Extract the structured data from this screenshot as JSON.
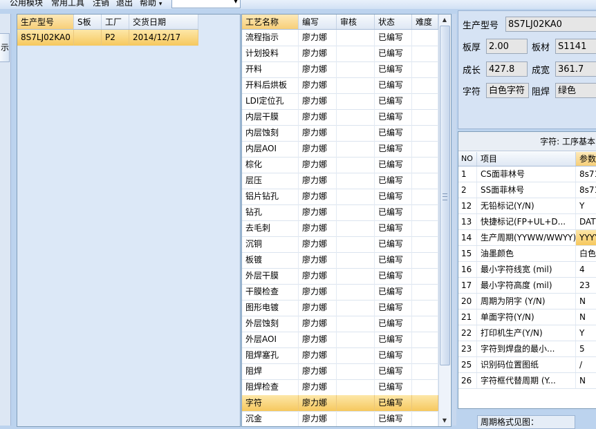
{
  "menu": {
    "items": [
      "公用模块",
      "常用工具",
      "注销",
      "退出",
      "帮助"
    ],
    "help_arrow": "▾"
  },
  "left_strip": {
    "button_label": "示"
  },
  "orders": {
    "columns": [
      "生产型号",
      "S板",
      "工厂",
      "交货日期"
    ],
    "rows": [
      [
        "8S7LJ02KA0",
        "",
        "P2",
        "2014/12/17"
      ]
    ]
  },
  "processes": {
    "columns": [
      "工艺名称",
      "编写",
      "审核",
      "状态",
      "难度"
    ],
    "rows": [
      [
        "流程指示",
        "廖力娜",
        "",
        "已编写",
        ""
      ],
      [
        "计划投料",
        "廖力娜",
        "",
        "已编写",
        ""
      ],
      [
        "开料",
        "廖力娜",
        "",
        "已编写",
        ""
      ],
      [
        "开料后烘板",
        "廖力娜",
        "",
        "已编写",
        ""
      ],
      [
        "LDI定位孔",
        "廖力娜",
        "",
        "已编写",
        ""
      ],
      [
        "内层干膜",
        "廖力娜",
        "",
        "已编写",
        ""
      ],
      [
        "内层蚀刻",
        "廖力娜",
        "",
        "已编写",
        ""
      ],
      [
        "内层AOI",
        "廖力娜",
        "",
        "已编写",
        ""
      ],
      [
        "棕化",
        "廖力娜",
        "",
        "已编写",
        ""
      ],
      [
        "层压",
        "廖力娜",
        "",
        "已编写",
        ""
      ],
      [
        "铝片钻孔",
        "廖力娜",
        "",
        "已编写",
        ""
      ],
      [
        "钻孔",
        "廖力娜",
        "",
        "已编写",
        ""
      ],
      [
        "去毛刺",
        "廖力娜",
        "",
        "已编写",
        ""
      ],
      [
        "沉铜",
        "廖力娜",
        "",
        "已编写",
        ""
      ],
      [
        "板镀",
        "廖力娜",
        "",
        "已编写",
        ""
      ],
      [
        "外层干膜",
        "廖力娜",
        "",
        "已编写",
        ""
      ],
      [
        "干膜检查",
        "廖力娜",
        "",
        "已编写",
        ""
      ],
      [
        "图形电镀",
        "廖力娜",
        "",
        "已编写",
        ""
      ],
      [
        "外层蚀刻",
        "廖力娜",
        "",
        "已编写",
        ""
      ],
      [
        "外层AOI",
        "廖力娜",
        "",
        "已编写",
        ""
      ],
      [
        "阻焊塞孔",
        "廖力娜",
        "",
        "已编写",
        ""
      ],
      [
        "阻焊",
        "廖力娜",
        "",
        "已编写",
        ""
      ],
      [
        "阻焊检查",
        "廖力娜",
        "",
        "已编写",
        ""
      ],
      [
        "字符",
        "廖力娜",
        "",
        "已编写",
        ""
      ],
      [
        "沉金",
        "廖力娜",
        "",
        "已编写",
        ""
      ]
    ],
    "selected_index": 23
  },
  "details": {
    "model_label": "生产型号",
    "model_value": "8S7LJ02KA0",
    "thickness_label": "板厚",
    "thickness_value": "2.00",
    "material_label": "板材",
    "material_value": "S1141",
    "length_label": "成长",
    "length_value": "427.8",
    "width_label": "成宽",
    "width_value": "361.7",
    "char_label": "字符",
    "char_value": "白色字符",
    "mask_label": "阻焊",
    "mask_value": "绿色"
  },
  "params": {
    "title": "字符: 工序基本",
    "columns": [
      "NO",
      "项目",
      "参数"
    ],
    "rows": [
      [
        "1",
        "CS面菲林号",
        "8s71"
      ],
      [
        "2",
        "SS面菲林号",
        "8s71"
      ],
      [
        "12",
        "无铅标记(Y/N)",
        "Y"
      ],
      [
        "13",
        "快捷标记(FP+UL+D...",
        "DATE"
      ],
      [
        "14",
        "生产周期(YYWW/WWYY)",
        "YYYY"
      ],
      [
        "15",
        "油墨颜色",
        "白色"
      ],
      [
        "16",
        "最小字符线宽 (mil)",
        "4"
      ],
      [
        "17",
        "最小字符高度 (mil)",
        "23"
      ],
      [
        "20",
        "周期为阴字 (Y/N)",
        "N"
      ],
      [
        "21",
        "单面字符(Y/N)",
        "N"
      ],
      [
        "22",
        "打印机生产(Y/N)",
        "Y"
      ],
      [
        "23",
        "字符到焊盘的最小...",
        "5"
      ],
      [
        "25",
        "识别码位置图纸",
        "/"
      ],
      [
        "26",
        "字符框代替周期 (Y...",
        "N"
      ]
    ],
    "highlight_index": 4
  },
  "bottom": {
    "label": "周期格式见图："
  }
}
